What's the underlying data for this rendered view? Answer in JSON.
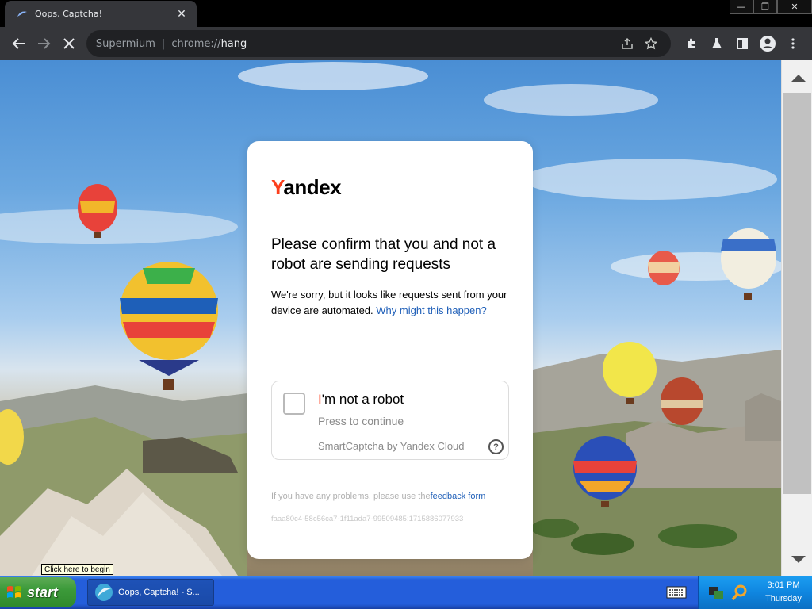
{
  "window": {
    "tab_title": "Oops, Captcha!",
    "tab_close": "✕",
    "minimize": "—",
    "restore": "❐",
    "close": "✕"
  },
  "toolbar": {
    "site_name": "Supermium",
    "separator": "|",
    "url_scheme": "chrome://",
    "url_host": "hang"
  },
  "captcha_page": {
    "logo_y": "Y",
    "logo_rest": "andex",
    "heading": "Please confirm that you and not a robot are sending requests",
    "description": "We're sorry, but it looks like requests sent from your device are automated.",
    "why_link": "Why might this happen?",
    "checkbox_label_i": "I",
    "checkbox_label_rest": "'m not a robot",
    "checkbox_sub": "Press to continue",
    "brand": "SmartCaptcha by Yandex Cloud",
    "help": "?",
    "problems_text": "If you have any problems, please use the",
    "feedback_link": "feedback form",
    "request_id": "faaa80c4-58c56ca7-1f11ada7-99509485:1715886077933"
  },
  "tooltip": "Click here to begin",
  "taskbar": {
    "start_label": "start",
    "task_button": "Oops, Captcha! - S...",
    "clock_time": "3:01 PM",
    "clock_day": "Thursday"
  },
  "colors": {
    "yandex_red": "#fc3f1d",
    "link_blue": "#1f5fb8",
    "xp_blue": "#245edb",
    "start_green": "#3c9a3a"
  }
}
